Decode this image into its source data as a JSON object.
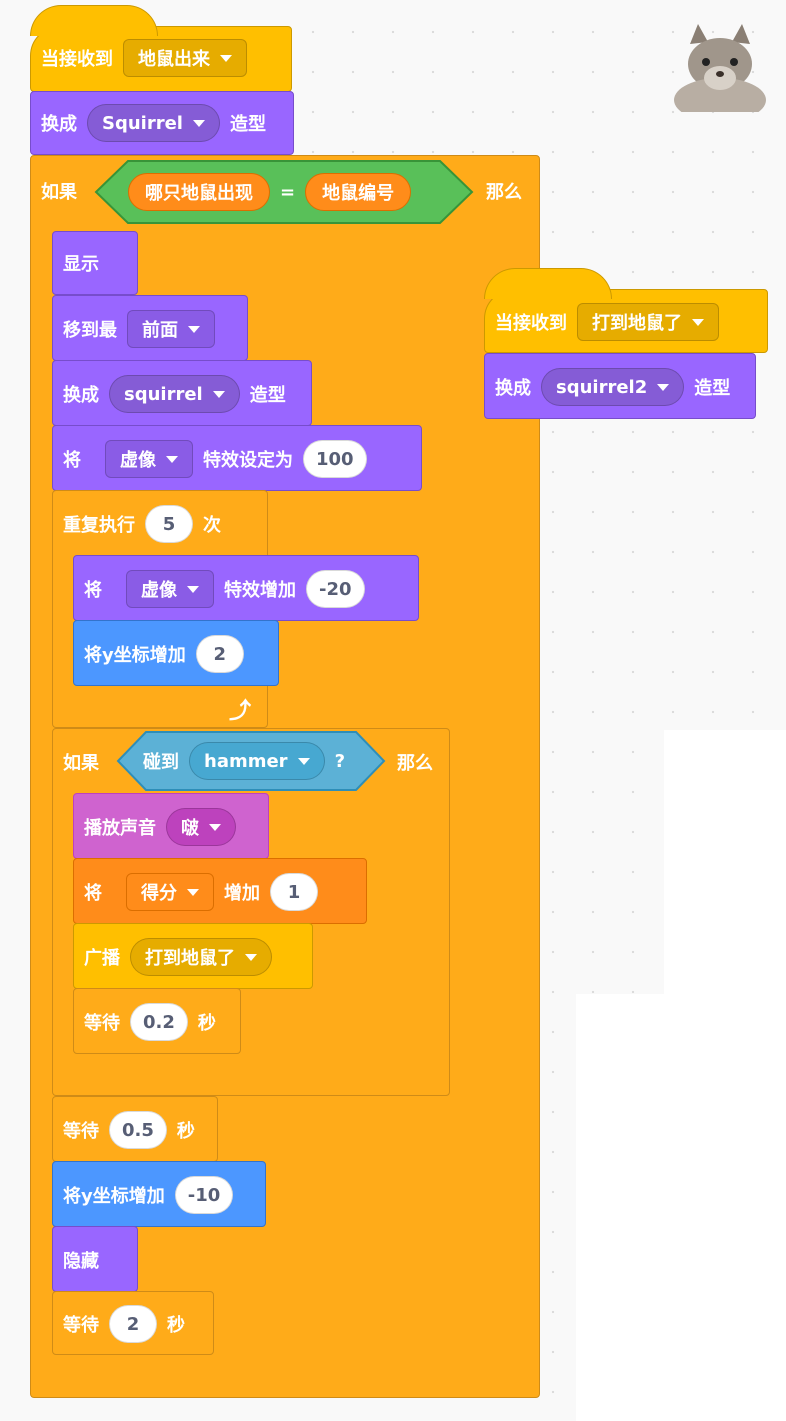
{
  "colors": {
    "events": "#ffbf00",
    "looks": "#9966ff",
    "control": "#ffab19",
    "motion": "#4c97ff",
    "sound": "#cf63cf",
    "variables": "#ff8c1a",
    "sensing": "#5cb1d6",
    "operators": "#59c059"
  },
  "sprite": {
    "icon": "squirrel-sprite-icon"
  },
  "script1": {
    "when_receive": {
      "label": "当接收到",
      "message": "地鼠出来"
    },
    "switch_costume": {
      "label": "换成",
      "costume": "Squirrel",
      "suffix": "造型"
    },
    "if1": {
      "label": "如果",
      "then": "那么",
      "left": "哪只地鼠出现",
      "op": "=",
      "right": "地鼠编号"
    },
    "show": {
      "label": "显示"
    },
    "go_front": {
      "label": "移到最",
      "value": "前面"
    },
    "switch_costume2": {
      "label": "换成",
      "costume": "squirrel",
      "suffix": "造型"
    },
    "set_effect": {
      "label": "将",
      "effect": "虚像",
      "mid": "特效设定为",
      "value": "100"
    },
    "repeat": {
      "label": "重复执行",
      "count": "5",
      "suffix": "次"
    },
    "change_effect": {
      "label": "将",
      "effect": "虚像",
      "mid": "特效增加",
      "value": "-20"
    },
    "change_y": {
      "label": "将y坐标增加",
      "value": "2"
    },
    "loop_icon": "loop-arrow-icon",
    "if2": {
      "label": "如果",
      "touch": "碰到",
      "object": "hammer",
      "q": "?",
      "then": "那么"
    },
    "play_sound": {
      "label": "播放声音",
      "sound": "啵"
    },
    "change_var": {
      "label": "将",
      "var": "得分",
      "mid": "增加",
      "value": "1"
    },
    "broadcast": {
      "label": "广播",
      "message": "打到地鼠了"
    },
    "wait1": {
      "label": "等待",
      "value": "0.2",
      "suffix": "秒"
    },
    "wait2": {
      "label": "等待",
      "value": "0.5",
      "suffix": "秒"
    },
    "change_y2": {
      "label": "将y坐标增加",
      "value": "-10"
    },
    "hide": {
      "label": "隐藏"
    },
    "wait3": {
      "label": "等待",
      "value": "2",
      "suffix": "秒"
    }
  },
  "script2": {
    "when_receive": {
      "label": "当接收到",
      "message": "打到地鼠了"
    },
    "switch_costume": {
      "label": "换成",
      "costume": "squirrel2",
      "suffix": "造型"
    }
  }
}
